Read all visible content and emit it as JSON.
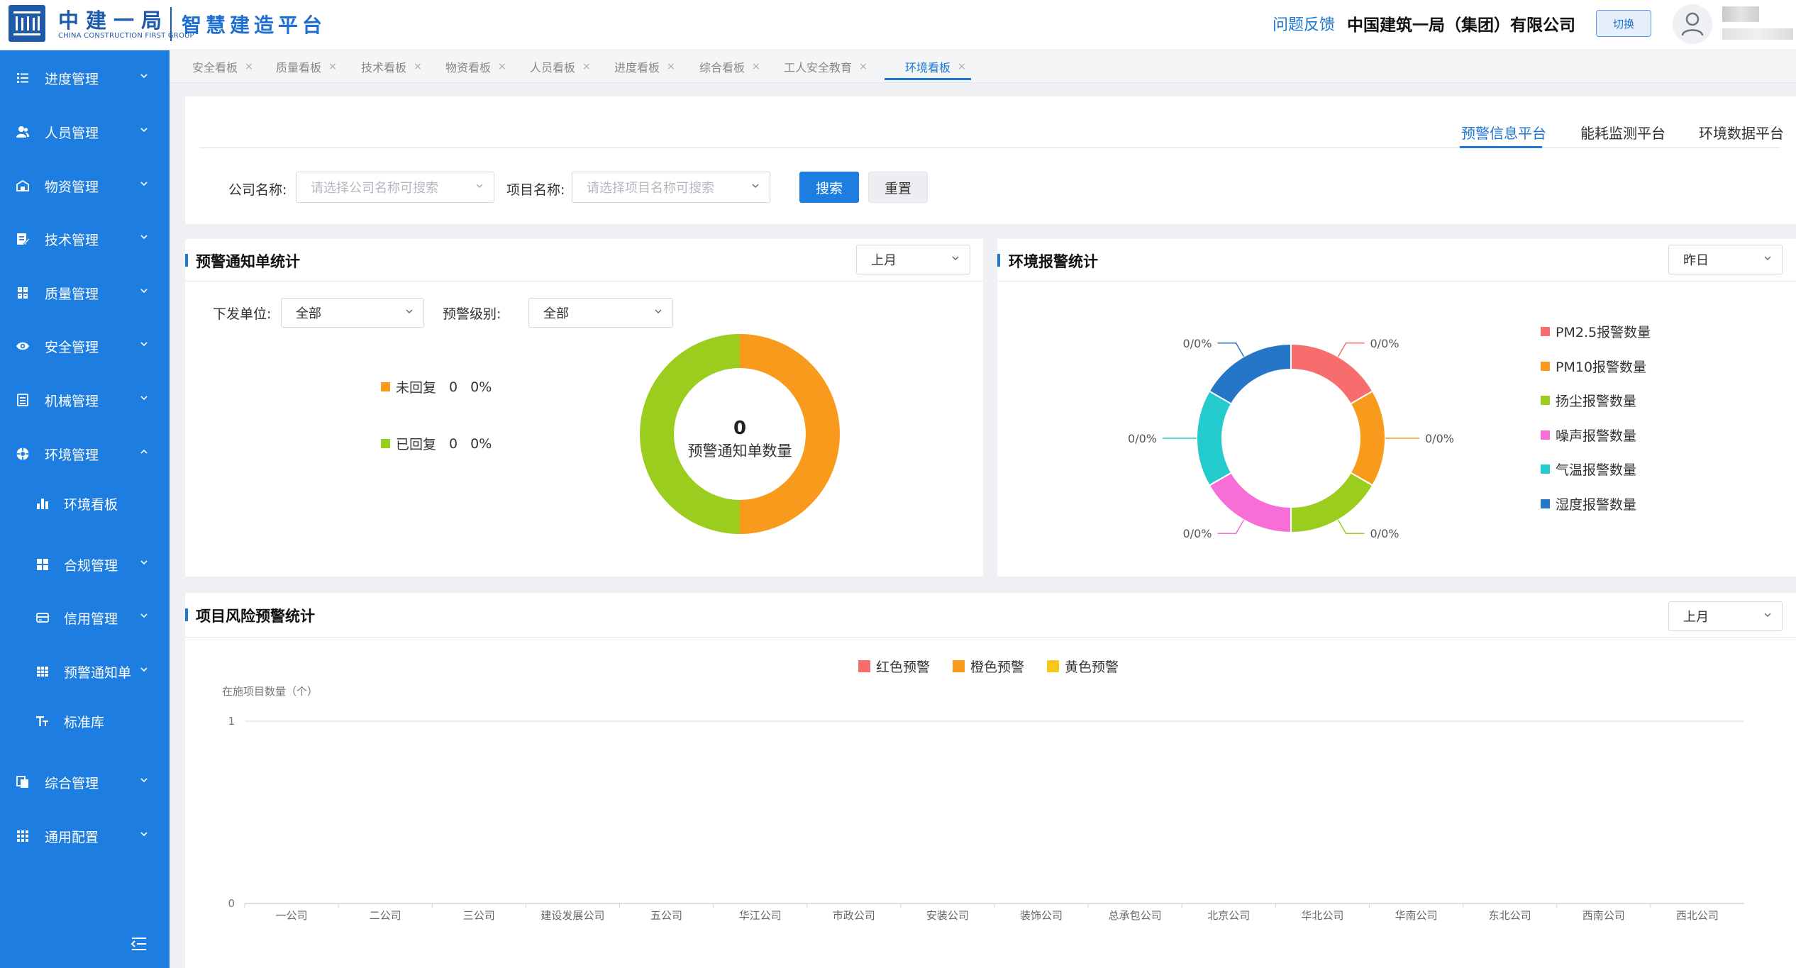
{
  "header": {
    "logo_text_cn": "中建一局",
    "logo_text_en": "CHINA CONSTRUCTION FIRST GROUP",
    "platform_name": "智慧建造平台",
    "feedback": "问题反馈",
    "org_name": "中国建筑一局（集团）有限公司",
    "switch_label": "切换"
  },
  "sidebar": {
    "items": [
      {
        "label": "进度管理",
        "icon": "list-icon",
        "expanded": false
      },
      {
        "label": "人员管理",
        "icon": "users-icon",
        "expanded": false
      },
      {
        "label": "物资管理",
        "icon": "warehouse-icon",
        "expanded": false
      },
      {
        "label": "技术管理",
        "icon": "document-edit-icon",
        "expanded": false
      },
      {
        "label": "质量管理",
        "icon": "quality-icon",
        "expanded": false
      },
      {
        "label": "安全管理",
        "icon": "eye-icon",
        "expanded": false
      },
      {
        "label": "机械管理",
        "icon": "machine-icon",
        "expanded": false
      },
      {
        "label": "环境管理",
        "icon": "environment-icon",
        "expanded": true
      },
      {
        "label": "环境看板",
        "icon": "bar-chart-icon",
        "sub": true
      },
      {
        "label": "合规管理",
        "icon": "grid-icon",
        "sub": true,
        "expanded": false
      },
      {
        "label": "信用管理",
        "icon": "credit-icon",
        "sub": true,
        "expanded": false
      },
      {
        "label": "预警通知单",
        "icon": "table-icon",
        "sub": true,
        "expanded": false
      },
      {
        "label": "标准库",
        "icon": "text-size-icon",
        "sub": true
      },
      {
        "label": "综合管理",
        "icon": "copy-icon",
        "expanded": false
      },
      {
        "label": "通用配置",
        "icon": "apps-icon",
        "expanded": false
      }
    ]
  },
  "tabs": [
    {
      "label": "安全看板"
    },
    {
      "label": "质量看板"
    },
    {
      "label": "技术看板"
    },
    {
      "label": "物资看板"
    },
    {
      "label": "人员看板"
    },
    {
      "label": "进度看板"
    },
    {
      "label": "综合看板"
    },
    {
      "label": "工人安全教育"
    },
    {
      "label": "环境看板",
      "active": true
    }
  ],
  "platform_tabs": [
    "预警信息平台",
    "能耗监测平台",
    "环境数据平台"
  ],
  "search": {
    "company_label": "公司名称:",
    "company_placeholder": "请选择公司名称可搜索",
    "project_label": "项目名称:",
    "project_placeholder": "请选择项目名称可搜索",
    "search_btn": "搜索",
    "reset_btn": "重置"
  },
  "notice_panel": {
    "title": "预警通知单统计",
    "period": "上月",
    "unit_label": "下发单位:",
    "unit_value": "全部",
    "level_label": "预警级别:",
    "level_value": "全部",
    "legend": [
      {
        "label": "未回复",
        "value": "0",
        "pct": "0%",
        "color": "#f89a1c"
      },
      {
        "label": "已回复",
        "value": "0",
        "pct": "0%",
        "color": "#9acd1e"
      }
    ],
    "center_value": "0",
    "center_label": "预警通知单数量"
  },
  "env_panel": {
    "title": "环境报警统计",
    "period": "昨日",
    "legend": [
      {
        "label": "PM2.5报警数量",
        "color": "#f76d6d"
      },
      {
        "label": "PM10报警数量",
        "color": "#f89a1c"
      },
      {
        "label": "扬尘报警数量",
        "color": "#9acd1e"
      },
      {
        "label": "噪声报警数量",
        "color": "#f76ed6"
      },
      {
        "label": "气温报警数量",
        "color": "#24cbcc"
      },
      {
        "label": "湿度报警数量",
        "color": "#2676c8"
      }
    ],
    "slice_label": "0/0%"
  },
  "risk_panel": {
    "title": "项目风险预警统计",
    "period": "上月"
  },
  "chart_data": [
    {
      "type": "pie",
      "categories": [
        "未回复",
        "已回复"
      ],
      "values": [
        0,
        0
      ]
    },
    {
      "type": "pie",
      "categories": [
        "PM2.5报警数量",
        "PM10报警数量",
        "扬尘报警数量",
        "噪声报警数量",
        "气温报警数量",
        "湿度报警数量"
      ],
      "values": [
        0,
        0,
        0,
        0,
        0,
        0
      ],
      "colors": [
        "#f76d6d",
        "#f89a1c",
        "#9acd1e",
        "#f76ed6",
        "#24cbcc",
        "#2676c8"
      ],
      "legend": "right"
    },
    {
      "type": "bar",
      "ylabel": "在施项目数量（个）",
      "ylim": [
        0,
        1
      ],
      "yticks": [
        "0",
        "1"
      ],
      "categories": [
        "一公司",
        "二公司",
        "三公司",
        "建设发展公司",
        "五公司",
        "华江公司",
        "市政公司",
        "安装公司",
        "装饰公司",
        "总承包公司",
        "北京公司",
        "华北公司",
        "华南公司",
        "东北公司",
        "西南公司",
        "西北公司"
      ],
      "series": [
        {
          "name": "红色预警",
          "color": "#f76d6d",
          "values": [
            0,
            0,
            0,
            0,
            0,
            0,
            0,
            0,
            0,
            0,
            0,
            0,
            0,
            0,
            0,
            0
          ]
        },
        {
          "name": "橙色预警",
          "color": "#f89a1c",
          "values": [
            0,
            0,
            0,
            0,
            0,
            0,
            0,
            0,
            0,
            0,
            0,
            0,
            0,
            0,
            0,
            0
          ]
        },
        {
          "name": "黄色预警",
          "color": "#f7c81c",
          "values": [
            0,
            0,
            0,
            0,
            0,
            0,
            0,
            0,
            0,
            0,
            0,
            0,
            0,
            0,
            0,
            0
          ]
        }
      ],
      "grid": true,
      "legend": "top-center"
    }
  ]
}
